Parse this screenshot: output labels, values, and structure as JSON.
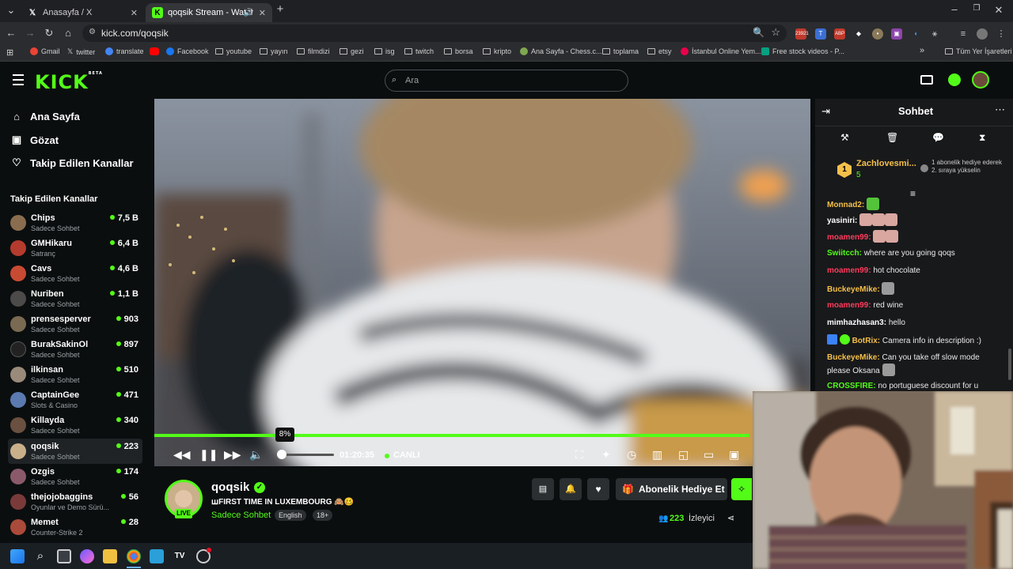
{
  "browser": {
    "tabs": [
      {
        "title": "Anasayfa / X",
        "icon": "x-logo-icon"
      },
      {
        "title": "qoqsik Stream - Watch Live",
        "icon": "kick-logo-icon",
        "active": true
      }
    ],
    "new_tab": "+",
    "url": "kick.com/qoqsik",
    "badge_count": "23921",
    "bookmarks": [
      "Gmail",
      "twitter",
      "translate",
      "",
      "Facebook",
      "youtube",
      "yayın",
      "filmdizi",
      "gezi",
      "isg",
      "twitch",
      "borsa",
      "kripto",
      "Ana Sayfa - Chess.c...",
      "toplama",
      "etsy",
      "İstanbul Online Yem...",
      "Free stock videos - P..."
    ],
    "bookmarks_more": "»",
    "all_bookmarks": "Tüm Yer İşaretleri"
  },
  "kick": {
    "logo": "KICK",
    "logo_badge": "BETA",
    "search_placeholder": "Ara"
  },
  "sidebar": {
    "nav": [
      {
        "label": "Ana Sayfa",
        "icon": "home-icon"
      },
      {
        "label": "Gözat",
        "icon": "browse-icon"
      },
      {
        "label": "Takip Edilen Kanallar",
        "icon": "heart-icon"
      }
    ],
    "followed_heading": "Takip Edilen Kanallar",
    "channels": [
      {
        "name": "Chips",
        "category": "Sadece Sohbet",
        "viewers": "7,5 B",
        "color": "#8a6d4f"
      },
      {
        "name": "GMHikaru",
        "category": "Satranç",
        "viewers": "6,4 B",
        "color": "#b53b2e"
      },
      {
        "name": "Cavs",
        "category": "Sadece Sohbet",
        "viewers": "4,6 B",
        "color": "#c94a32"
      },
      {
        "name": "Nuriben",
        "category": "Sadece Sohbet",
        "viewers": "1,1 B",
        "color": "#4d4a4a"
      },
      {
        "name": "prensesperver",
        "category": "Sadece Sohbet",
        "viewers": "903",
        "color": "#7a6a52"
      },
      {
        "name": "BurakSakinOl",
        "category": "Sadece Sohbet",
        "viewers": "897",
        "color": "#222222"
      },
      {
        "name": "ilkinsan",
        "category": "Sadece Sohbet",
        "viewers": "510",
        "color": "#9a8a7a"
      },
      {
        "name": "CaptainGee",
        "category": "Slots & Casino",
        "viewers": "471",
        "color": "#5a7ab0"
      },
      {
        "name": "Killayda",
        "category": "Sadece Sohbet",
        "viewers": "340",
        "color": "#6a5040"
      },
      {
        "name": "qoqsik",
        "category": "Sadece Sohbet",
        "viewers": "223",
        "color": "#c9b08a"
      },
      {
        "name": "Ozgis",
        "category": "Sadece Sohbet",
        "viewers": "174",
        "color": "#8a5a6a"
      },
      {
        "name": "thejojobaggins",
        "category": "Oyunlar ve Demo Sürü...",
        "viewers": "56",
        "color": "#7a3a3a"
      },
      {
        "name": "Memet",
        "category": "Counter-Strike 2",
        "viewers": "28",
        "color": "#aa4a3a"
      }
    ]
  },
  "player": {
    "progress_tooltip": "8%",
    "volume_fraction": 0.08,
    "elapsed": "01:20:35",
    "live_label": "CANLI",
    "progress_fraction": 0.99
  },
  "stream": {
    "channel": "qoqsik",
    "title": "ꟺFIRST TIME IN LUXEMBOURG 🙈🥴",
    "category": "Sadece Sohbet",
    "tags": [
      "English",
      "18+"
    ],
    "live_badge": "LIVE",
    "subscribe_gift": "Abonelik Hediye Et",
    "viewer_count": "223",
    "viewer_label": "İzleyici"
  },
  "chat": {
    "title": "Sohbet",
    "pinned_user": "Zachlovesmi...",
    "pinned_rank": "1",
    "pinned_count": "5",
    "pinned_note": "1 abonelik hediye ederek 2. sıraya yükselin",
    "messages": [
      {
        "user": "Monnad2:",
        "text": "",
        "color": "#f5c04a",
        "emotes": 1
      },
      {
        "user": "yasiniri:",
        "text": "",
        "color": "#ffffff",
        "emotes": 3
      },
      {
        "user": "moamen99:",
        "text": "",
        "color": "#ff3b5c",
        "emotes": 2
      },
      {
        "user": "Swiitcch:",
        "text": "where are you going qoqs",
        "color": "#53fc18",
        "emotes": 0
      },
      {
        "user": "moamen99:",
        "text": "hot chocolate",
        "color": "#ff3b5c",
        "emotes": 0
      },
      {
        "user": "BuckeyeMike:",
        "text": "",
        "color": "#f5c04a",
        "emotes": 1
      },
      {
        "user": "moamen99:",
        "text": "red wine",
        "color": "#ff3b5c",
        "emotes": 0
      },
      {
        "user": "mimhazhasan3:",
        "text": "hello",
        "color": "#ffffff",
        "emotes": 0
      },
      {
        "user": "BotRix:",
        "text": "Camera info in description :)",
        "color": "#f5c04a",
        "emotes": 0
      },
      {
        "user": "BuckeyeMike:",
        "text": "Can you take off slow mode please Oksana",
        "color": "#f5c04a",
        "emotes": 1
      },
      {
        "user": "CROSSFIRE:",
        "text": "no portuguese discount for u",
        "color": "#53fc18",
        "emotes": 0
      }
    ]
  },
  "colors": {
    "kick_green": "#53fc18",
    "background": "#0b0e0f",
    "chat_bg": "#18191b"
  }
}
